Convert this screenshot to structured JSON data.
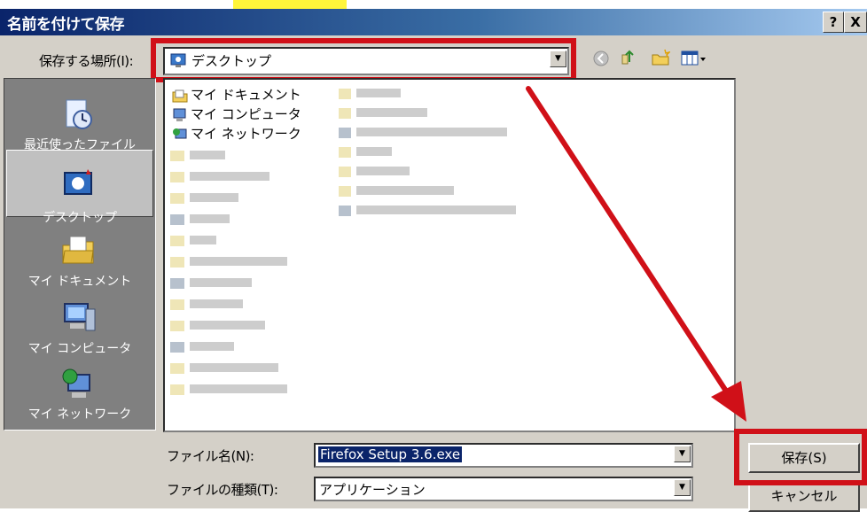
{
  "window": {
    "title": "名前を付けて保存",
    "help_label": "?",
    "close_label": "X"
  },
  "toolbar": {
    "save_in_label": "保存する場所(I):",
    "location_value": "デスクトップ"
  },
  "places": [
    {
      "label": "最近使ったファイル",
      "icon": "recent-files-icon"
    },
    {
      "label": "デスクトップ",
      "icon": "desktop-icon",
      "selected": true
    },
    {
      "label": "マイ ドキュメント",
      "icon": "my-documents-icon"
    },
    {
      "label": "マイ コンピュータ",
      "icon": "my-computer-icon"
    },
    {
      "label": "マイ ネットワーク",
      "icon": "my-network-icon"
    }
  ],
  "files": [
    {
      "label": "マイ ドキュメント",
      "icon": "folder-documents-icon"
    },
    {
      "label": "マイ コンピュータ",
      "icon": "computer-icon"
    },
    {
      "label": "マイ ネットワーク",
      "icon": "network-icon"
    }
  ],
  "form": {
    "filename_label": "ファイル名(N):",
    "filename_value": "Firefox Setup 3.6.exe",
    "filetype_label": "ファイルの種類(T):",
    "filetype_value": "アプリケーション"
  },
  "buttons": {
    "save_label": "保存(S)",
    "cancel_label": "キャンセル"
  },
  "colors": {
    "annotation_red": "#d01018",
    "highlight_yellow": "#fff53a",
    "title_blue": "#0a246a"
  }
}
